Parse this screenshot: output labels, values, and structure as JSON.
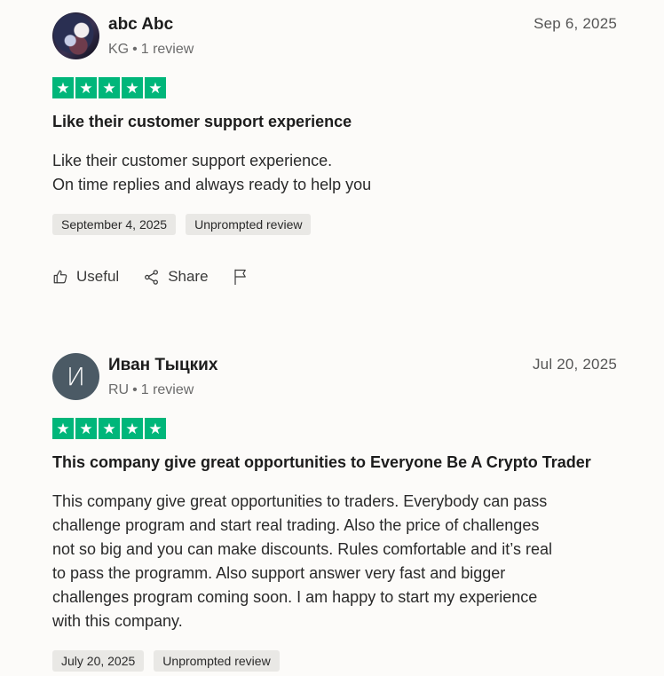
{
  "reviews": [
    {
      "author": "abc Abc",
      "country": "KG",
      "review_count": "1 review",
      "date": "Sep 6, 2025",
      "rating": 5,
      "title": "Like their customer support experience",
      "body_lines": [
        "Like their customer support experience.",
        "On time replies and always ready to help you"
      ],
      "experience_date": "September 4, 2025",
      "tag": "Unprompted review",
      "actions": {
        "useful": "Useful",
        "share": "Share"
      }
    },
    {
      "author": "Иван Тыцких",
      "avatar_initial": "И",
      "country": "RU",
      "review_count": "1 review",
      "date": "Jul 20, 2025",
      "rating": 5,
      "title": "This company give great opportunities to Everyone Be A Crypto Trader",
      "body_lines": [
        "This company give great opportunities to traders. Everybody can pass",
        "challenge program and start real trading. Also the price of challenges",
        "not so big and you can make discounts. Rules comfortable and it’s real",
        "to pass the programm. Also support answer very fast and bigger",
        "challenges program coming soon. I am happy to start my experience",
        "with this company."
      ],
      "experience_date": "July 20, 2025",
      "tag": "Unprompted review"
    }
  ],
  "icons": {
    "star": "star-icon",
    "useful": "thumbs-up-icon",
    "share": "share-icon",
    "report": "flag-icon"
  },
  "colors": {
    "star_bg": "#00b67a",
    "avatar_bg": "#4b5a65",
    "tag_bg": "#e9e8e5"
  }
}
